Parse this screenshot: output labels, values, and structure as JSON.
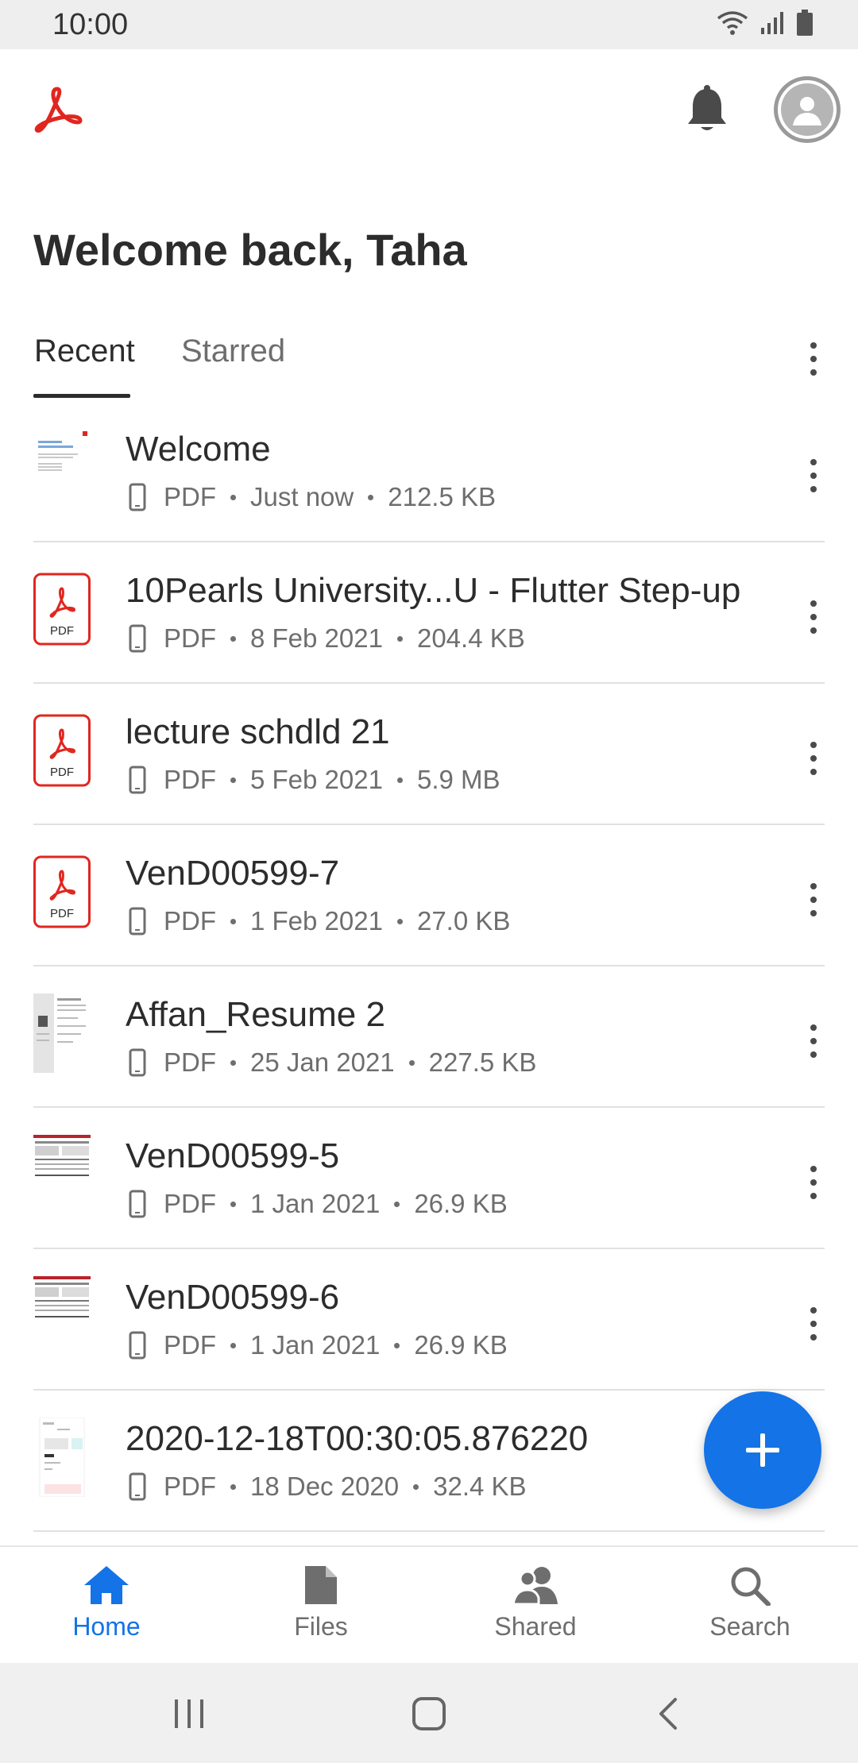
{
  "status_bar": {
    "time": "10:00"
  },
  "header": {
    "welcome": "Welcome back, Taha"
  },
  "tabs": {
    "recent": "Recent",
    "starred": "Starred"
  },
  "files": [
    {
      "name": "Welcome",
      "type": "PDF",
      "date": "Just now",
      "size": "212.5 KB",
      "thumb": "doc-preview-welcome"
    },
    {
      "name": "10Pearls University...U - Flutter Step-up",
      "type": "PDF",
      "date": "8 Feb 2021",
      "size": "204.4 KB",
      "thumb": "pdf-icon"
    },
    {
      "name": "lecture schdld 21",
      "type": "PDF",
      "date": "5 Feb 2021",
      "size": "5.9 MB",
      "thumb": "pdf-icon"
    },
    {
      "name": "VenD00599-7",
      "type": "PDF",
      "date": "1 Feb 2021",
      "size": "27.0 KB",
      "thumb": "pdf-icon"
    },
    {
      "name": "Affan_Resume 2",
      "type": "PDF",
      "date": "25 Jan 2021",
      "size": "227.5 KB",
      "thumb": "doc-preview-resume"
    },
    {
      "name": "VenD00599-5",
      "type": "PDF",
      "date": "1 Jan 2021",
      "size": "26.9 KB",
      "thumb": "doc-preview-table"
    },
    {
      "name": "VenD00599-6",
      "type": "PDF",
      "date": "1 Jan 2021",
      "size": "26.9 KB",
      "thumb": "doc-preview-table"
    },
    {
      "name": "2020-12-18T00:30:05.876220",
      "type": "PDF",
      "date": "18 Dec 2020",
      "size": "32.4 KB",
      "thumb": "doc-preview-form"
    }
  ],
  "pdf_icon_label": "PDF",
  "bottom_nav": [
    {
      "label": "Home",
      "icon": "home-icon",
      "active": true
    },
    {
      "label": "Files",
      "icon": "files-icon",
      "active": false
    },
    {
      "label": "Shared",
      "icon": "shared-icon",
      "active": false
    },
    {
      "label": "Search",
      "icon": "search-icon",
      "active": false
    }
  ],
  "colors": {
    "accent": "#1473e6",
    "acrobat_red": "#e0271f",
    "text": "#2c2c2c",
    "muted": "#6e6e6e"
  }
}
